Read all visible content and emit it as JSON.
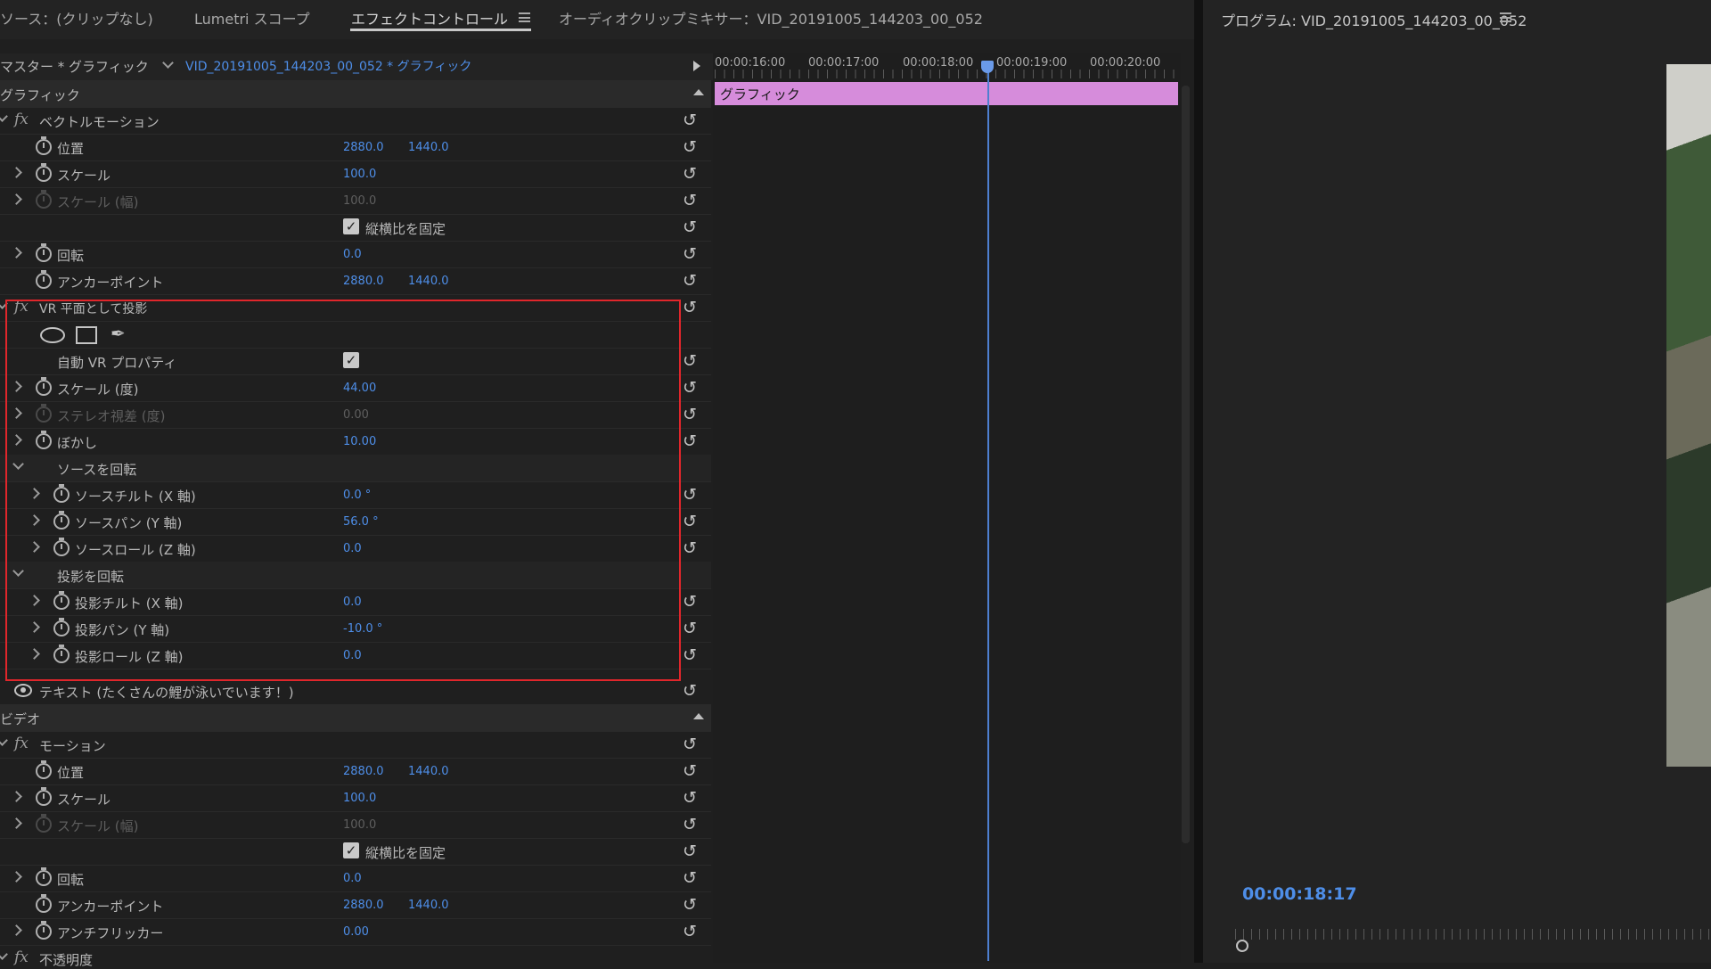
{
  "tabs": [
    {
      "label": "ソース：(クリップなし)",
      "active": false
    },
    {
      "label": "Lumetri スコープ",
      "active": false
    },
    {
      "label": "エフェクトコントロール",
      "active": true
    },
    {
      "label": "オーディオクリップミキサー：VID_20191005_144203_00_052",
      "active": false
    }
  ],
  "header": {
    "master": "マスター * グラフィック",
    "clip": "VID_20191005_144203_00_052 * グラフィック"
  },
  "timeline": {
    "timecodes": [
      "00:00:16:00",
      "00:00:17:00",
      "00:00:18:00",
      "00:00:19:00",
      "00:00:20:00"
    ],
    "clip_label": "グラフィック"
  },
  "sections": {
    "graphic": "グラフィック",
    "video": "ビデオ"
  },
  "vector_motion": {
    "title": "ベクトルモーション",
    "position_label": "位置",
    "position_x": "2880.0",
    "position_y": "1440.0",
    "scale_label": "スケール",
    "scale": "100.0",
    "scale_width_label": "スケール (幅)",
    "scale_width": "100.0",
    "uniform_label": "縦横比を固定",
    "rotation_label": "回転",
    "rotation": "0.0",
    "anchor_label": "アンカーポイント",
    "anchor_x": "2880.0",
    "anchor_y": "1440.0"
  },
  "vr": {
    "title": "VR 平面として投影",
    "auto_label": "自動 VR プロパティ",
    "scale_label": "スケール (度)",
    "scale": "44.00",
    "stereo_label": "ステレオ視差 (度)",
    "stereo": "0.00",
    "blur_label": "ぼかし",
    "blur": "10.00",
    "rotate_source": "ソースを回転",
    "src_tilt_label": "ソースチルト (X 軸)",
    "src_tilt": "0.0 °",
    "src_pan_label": "ソースパン (Y 軸)",
    "src_pan": "56.0 °",
    "src_roll_label": "ソースロール (Z 軸)",
    "src_roll": "0.0",
    "rotate_projection": "投影を回転",
    "proj_tilt_label": "投影チルト (X 軸)",
    "proj_tilt": "0.0",
    "proj_pan_label": "投影パン (Y 軸)",
    "proj_pan": "-10.0 °",
    "proj_roll_label": "投影ロール (Z 軸)",
    "proj_roll": "0.0"
  },
  "text_layer": "テキスト (たくさんの鯉が泳いでいます！)",
  "motion": {
    "title": "モーション",
    "position_label": "位置",
    "position_x": "2880.0",
    "position_y": "1440.0",
    "scale_label": "スケール",
    "scale": "100.0",
    "scale_width_label": "スケール (幅)",
    "scale_width": "100.0",
    "uniform_label": "縦横比を固定",
    "rotation_label": "回転",
    "rotation": "0.0",
    "anchor_label": "アンカーポイント",
    "anchor_x": "2880.0",
    "anchor_y": "1440.0",
    "antiflicker_label": "アンチフリッカー",
    "antiflicker": "0.00"
  },
  "opacity_title": "不透明度",
  "program": {
    "title": "プログラム: VID_20191005_144203_00_052",
    "timecode": "00:00:18:17"
  },
  "colors": {
    "accent_blue": "#4e8ee8",
    "clip_pink": "#d68cdb",
    "highlight_red": "#e0262b"
  }
}
